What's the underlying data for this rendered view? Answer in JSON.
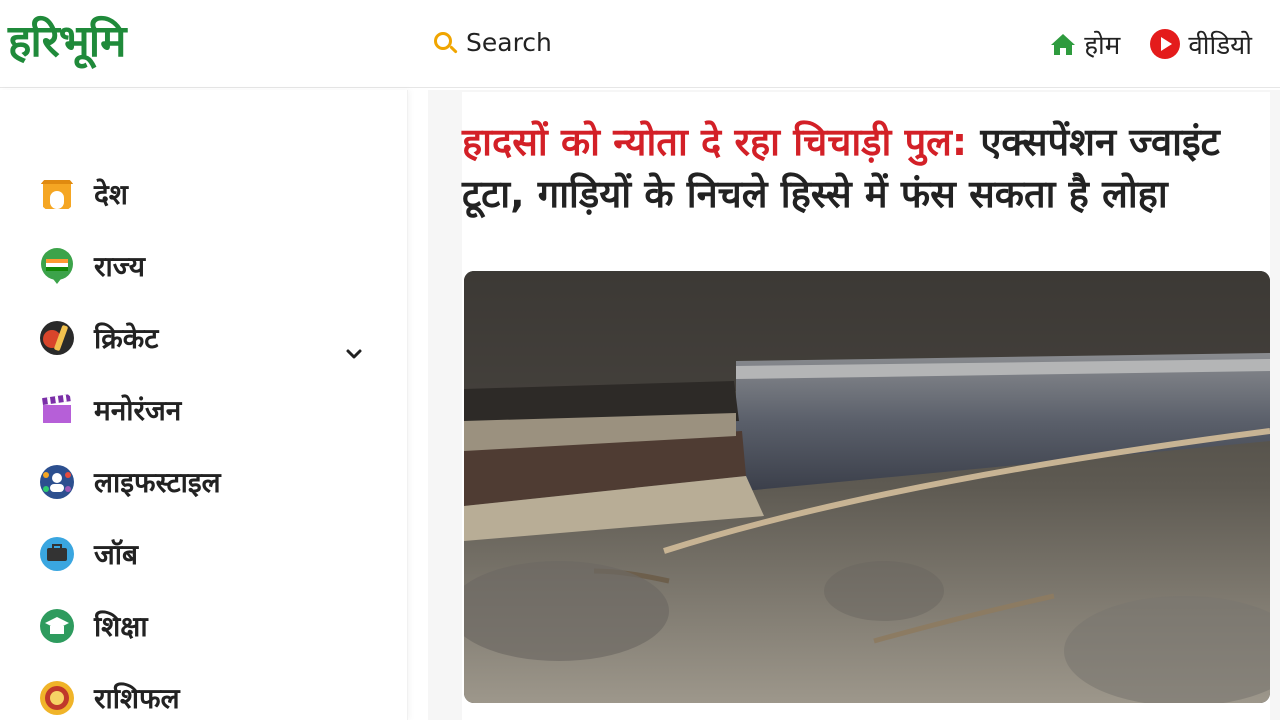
{
  "header": {
    "logo_text": "हरिभूमि",
    "search_label": "Search",
    "nav": [
      {
        "label": "होम",
        "icon": "home-icon"
      },
      {
        "label": "वीडियो",
        "icon": "video-play-icon"
      }
    ]
  },
  "sidebar": {
    "items": [
      {
        "label": "देश",
        "icon": "india-gate-icon"
      },
      {
        "label": "राज्य",
        "icon": "india-map-icon"
      },
      {
        "label": "क्रिकेट",
        "icon": "cricket-icon"
      },
      {
        "label": "मनोरंजन",
        "icon": "clapperboard-icon"
      },
      {
        "label": "लाइफस्टाइल",
        "icon": "lifestyle-icon"
      },
      {
        "label": "जॉब",
        "icon": "job-icon"
      },
      {
        "label": "शिक्षा",
        "icon": "education-icon"
      },
      {
        "label": "राशिफल",
        "icon": "om-icon"
      }
    ]
  },
  "article": {
    "headline_highlight": "हादसों को न्योता दे रहा चिचाड़ी पुल:",
    "headline_rest": " एक्सपेंशन ज्वाइंट टूटा, गाड़ियों के निचले हिस्से में फंस सकता है लोहा"
  },
  "colors": {
    "brand_green": "#1f8a3a",
    "headline_red": "#d32027",
    "search_orange": "#f0a500",
    "video_red": "#e41b1b"
  }
}
